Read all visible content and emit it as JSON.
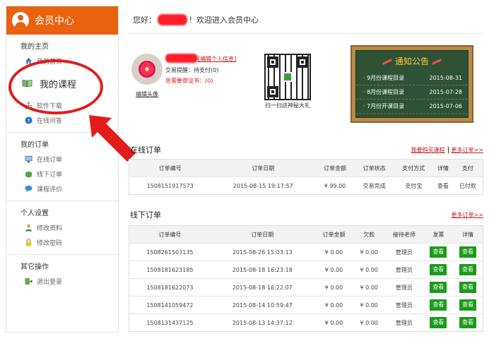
{
  "sidebar": {
    "title": "会员中心",
    "sections": [
      {
        "title": "我的主页",
        "items": [
          {
            "label": "我的首页",
            "icon": "home-icon"
          },
          {
            "label": "我的课程",
            "icon": "book-icon"
          },
          {
            "label": "软件下载",
            "icon": "download-icon"
          },
          {
            "label": "在线问答",
            "icon": "question-icon"
          }
        ]
      },
      {
        "title": "我的订单",
        "items": [
          {
            "label": "在线订单",
            "icon": "monitor-icon"
          },
          {
            "label": "线下订单",
            "icon": "box-icon"
          },
          {
            "label": "课程评价",
            "icon": "comment-icon"
          }
        ]
      },
      {
        "title": "个人设置",
        "items": [
          {
            "label": "修改资料",
            "icon": "user-icon"
          },
          {
            "label": "修改密码",
            "icon": "lock-icon"
          }
        ]
      },
      {
        "title": "其它操作",
        "items": [
          {
            "label": "退出登录",
            "icon": "logout-icon"
          }
        ]
      }
    ]
  },
  "welcome": {
    "prefix": "您好：",
    "suffix": "！欢迎进入会员中心"
  },
  "profile": {
    "edit_info": "[编辑个人信息]",
    "tx_label": "交易提醒：",
    "tx_value": "待支付(0)",
    "cert_label": "急需要审证书：",
    "cert_value": "(0)",
    "edit_avatar": "编辑头像"
  },
  "qr": {
    "caption": "扫一扫送神秘大礼"
  },
  "notice": {
    "title": "通知公告",
    "items": [
      {
        "label": "· 9月份课程目录",
        "date": "2015-08-31"
      },
      {
        "label": "· 8月份课程目录",
        "date": "2015-07-28"
      },
      {
        "label": "· 7月份开课目录",
        "date": "2015-07-06"
      }
    ]
  },
  "online_orders": {
    "title": "在线订单",
    "buy_link": "我要购买课程",
    "more_link": "更多订单>>",
    "headers": [
      "订单编号",
      "订单日期",
      "订单金额",
      "订单状态",
      "支付方式",
      "详情",
      "支付"
    ],
    "rows": [
      [
        "1508151917573",
        "2015-08-15 19:17:57",
        "¥ 99.00",
        "交易完成",
        "支付宝",
        "查看",
        "已付款"
      ]
    ]
  },
  "offline_orders": {
    "title": "线下订单",
    "more_link": "更多订单>>",
    "headers": [
      "订单编号",
      "订单日期",
      "订单金额",
      "欠款",
      "接待老师",
      "发票",
      "详情"
    ],
    "button_label": "查看",
    "rows": [
      [
        "1508261503135",
        "2015-08-26 15:03:13",
        "¥ 0.00",
        "¥ 0.00",
        "管理员"
      ],
      [
        "1508181623185",
        "2015-08-18 16:23:18",
        "¥ 0.00",
        "¥ 0.00",
        "管理员"
      ],
      [
        "1508181622073",
        "2015-08-18 16:22:07",
        "¥ 0.00",
        "¥ 0.00",
        "管理员"
      ],
      [
        "1508141059472",
        "2015-08-14 10:59:47",
        "¥ 0.00",
        "¥ 0.00",
        "管理员"
      ],
      [
        "1508131437125",
        "2015-08-13 14:37:12",
        "¥ 0.00",
        "¥ 0.00",
        "管理员"
      ]
    ]
  },
  "colors": {
    "accent": "#e8620f",
    "highlight": "#e21b1b",
    "button": "#1a9b1a",
    "board": "#2f5135"
  }
}
